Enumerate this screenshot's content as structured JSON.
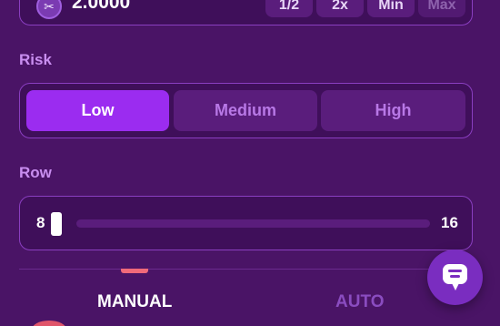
{
  "bet": {
    "amount": "2.0000",
    "coin_icon": "scissors-coin-icon",
    "quick_buttons": [
      {
        "label": "1/2"
      },
      {
        "label": "2x"
      },
      {
        "label": "Min"
      },
      {
        "label": "Max"
      }
    ]
  },
  "risk": {
    "label": "Risk",
    "options": [
      {
        "label": "Low",
        "active": true
      },
      {
        "label": "Medium",
        "active": false
      },
      {
        "label": "High",
        "active": false
      }
    ]
  },
  "row": {
    "label": "Row",
    "min": "8",
    "max": "16",
    "value": 8
  },
  "mode_tabs": [
    {
      "label": "MANUAL",
      "active": true
    },
    {
      "label": "AUTO",
      "active": false
    }
  ],
  "chat": {
    "icon": "chat-icon"
  },
  "colors": {
    "background": "#4a1466",
    "accent": "#9b2cf0",
    "tab_indicator": "#f06a7a"
  }
}
